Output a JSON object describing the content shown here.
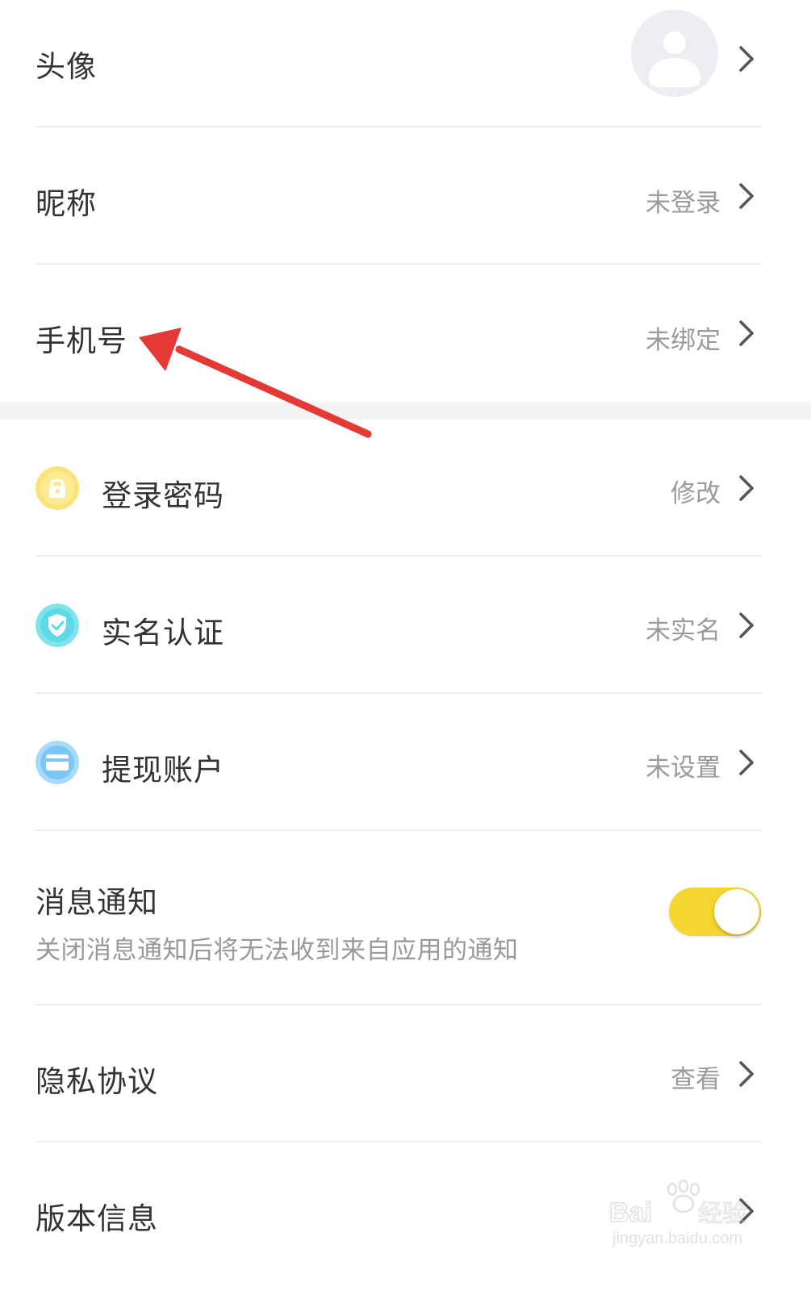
{
  "rows": {
    "avatar": {
      "label": "头像"
    },
    "nickname": {
      "label": "昵称",
      "value": "未登录"
    },
    "phone": {
      "label": "手机号",
      "value": "未绑定"
    },
    "password": {
      "label": "登录密码",
      "value": "修改"
    },
    "realname": {
      "label": "实名认证",
      "value": "未实名"
    },
    "withdraw": {
      "label": "提现账户",
      "value": "未设置"
    },
    "notification": {
      "label": "消息通知",
      "description": "关闭消息通知后将无法收到来自应用的通知",
      "enabled": true
    },
    "privacy": {
      "label": "隐私协议",
      "value": "查看"
    },
    "version": {
      "label": "版本信息",
      "value": ""
    }
  },
  "annotation": {
    "arrow_color": "#e53935"
  },
  "watermark": {
    "logo_text": "Baidu经验",
    "url": "jingyan.baidu.com"
  },
  "colors": {
    "toggle_on": "#f6d431",
    "lock_icon": "#fbe37a",
    "shield_icon": "#5fd9e6",
    "card_icon": "#7cc6f6",
    "value_text": "#9a9a9a"
  }
}
